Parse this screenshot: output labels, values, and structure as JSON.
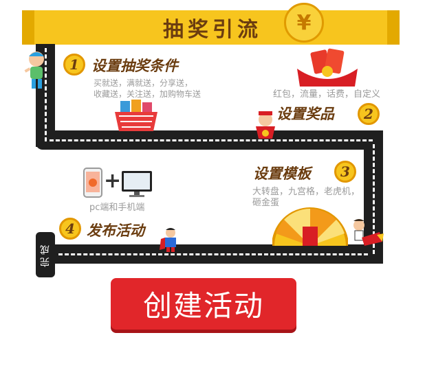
{
  "banner": {
    "title": "抽奖引流",
    "coin_symbol": "¥"
  },
  "steps": [
    {
      "number": "1",
      "title": "设置抽奖条件",
      "desc_lines": [
        "买就送，满就送，分享送，",
        "收藏送，关注送，加购物车送"
      ]
    },
    {
      "number": "2",
      "title": "设置奖品",
      "desc_lines": [
        "红包，流量，话费，自定义"
      ]
    },
    {
      "number": "3",
      "title": "设置模板",
      "desc_lines": [
        "大转盘，九宫格，老虎机，",
        "砸金蛋"
      ]
    },
    {
      "number": "4",
      "title": "发布活动",
      "desc_lines": [
        "pc端和手机端"
      ]
    }
  ],
  "plus_sign": "+",
  "finish_label": "完成",
  "create_button": "创建活动",
  "colors": {
    "banner": "#f7c51e",
    "road": "#1f1f1f",
    "button": "#e1262a",
    "title_text": "#6b3d10"
  }
}
